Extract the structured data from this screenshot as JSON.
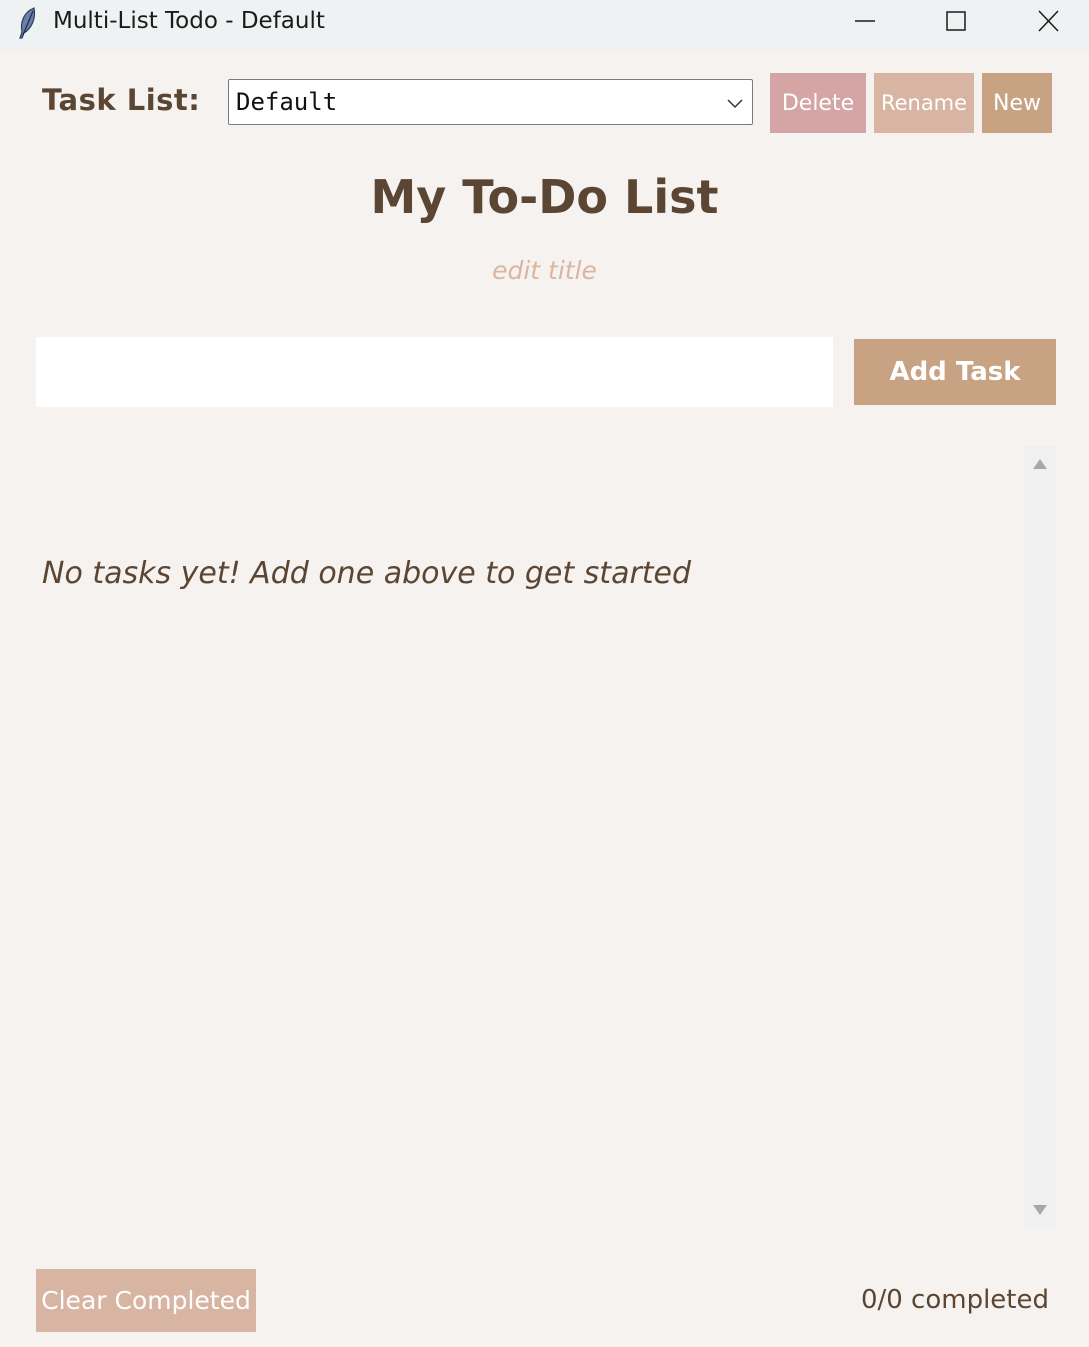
{
  "window": {
    "title": "Multi-List Todo - Default",
    "icon": "feather-icon",
    "controls": [
      "minimize-icon",
      "maximize-icon",
      "close-icon"
    ]
  },
  "header": {
    "task_list_label": "Task List:",
    "selected_list": "Default",
    "delete_label": "Delete",
    "rename_label": "Rename",
    "new_label": "New"
  },
  "main": {
    "title": "My To-Do List",
    "edit_title_label": "edit title",
    "task_input_value": "",
    "add_task_label": "Add Task",
    "empty_message": "No tasks yet! Add one above to get started"
  },
  "footer": {
    "clear_completed_label": "Clear Completed",
    "completed_status": "0/0 completed"
  },
  "colors": {
    "background": "#f6f2ef",
    "text_brown": "#5a4632",
    "delete_button": "#d4a5a4",
    "rename_button": "#d7b5a2",
    "new_button": "#c7a384",
    "add_task_button": "#c7a384",
    "edit_title_text": "#dcb5a0"
  }
}
